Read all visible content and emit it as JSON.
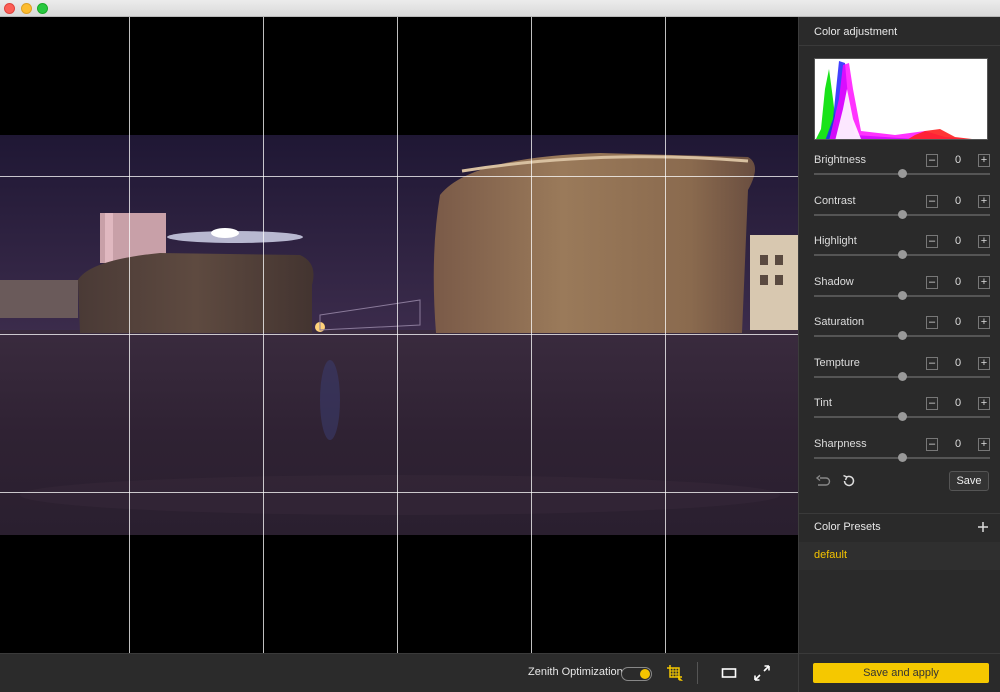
{
  "window": {
    "controls": [
      "close",
      "minimize",
      "zoom"
    ]
  },
  "sidebar": {
    "color_adjustment_title": "Color adjustment",
    "sliders": [
      {
        "label": "Brightness",
        "value": "0",
        "level": 0.5
      },
      {
        "label": "Contrast",
        "value": "0",
        "level": 0.5
      },
      {
        "label": "Highlight",
        "value": "0",
        "level": 0.5
      },
      {
        "label": "Shadow",
        "value": "0",
        "level": 0.5
      },
      {
        "label": "Saturation",
        "value": "0",
        "level": 0.5
      },
      {
        "label": "Tempture",
        "value": "0",
        "level": 0.5
      },
      {
        "label": "Tint",
        "value": "0",
        "level": 0.5
      },
      {
        "label": "Sharpness",
        "value": "0",
        "level": 0.5
      }
    ],
    "minus_glyph": "–",
    "plus_glyph": "+",
    "undo_icon": "undo-icon",
    "reset_icon": "reset-icon",
    "save_label": "Save",
    "color_presets_title": "Color Presets",
    "add_preset_glyph": "+",
    "presets": [
      "default"
    ],
    "apply_label": "Save and apply"
  },
  "bottombar": {
    "zenith_label": "Zenith Optimization",
    "zenith_enabled": true,
    "icons": [
      "crop-grid-icon",
      "aspect-rect-icon",
      "fullscreen-icon"
    ]
  },
  "colors": {
    "accent": "#f5c800",
    "sidebar_bg": "#2a2a2a",
    "toolbar_bg": "#2b2b2b"
  }
}
